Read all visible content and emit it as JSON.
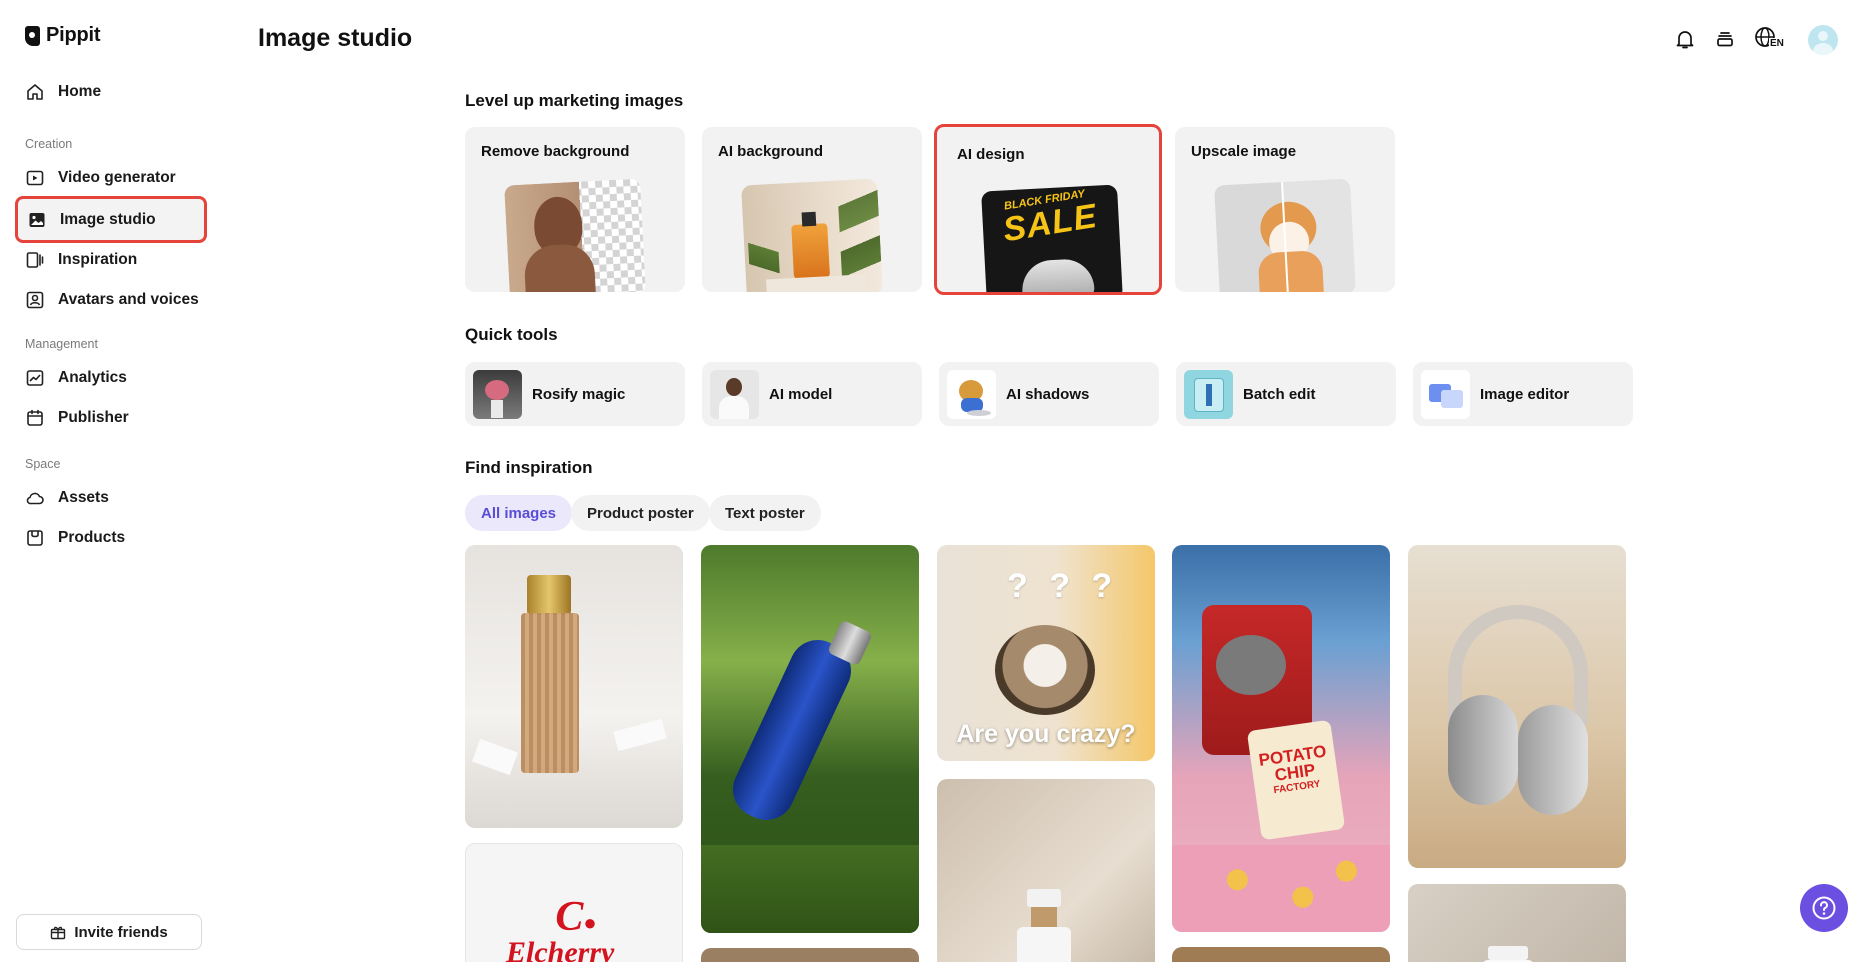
{
  "app": {
    "name": "Pippit"
  },
  "sidebar": {
    "home": "Home",
    "sections": {
      "creation": "Creation",
      "management": "Management",
      "space": "Space"
    },
    "items": {
      "video_generator": "Video generator",
      "image_studio": "Image studio",
      "inspiration": "Inspiration",
      "avatars_voices": "Avatars and voices",
      "analytics": "Analytics",
      "publisher": "Publisher",
      "assets": "Assets",
      "products": "Products"
    },
    "invite": "Invite friends"
  },
  "header": {
    "title": "Image studio",
    "language_badge": "EN"
  },
  "main": {
    "level_up": {
      "title": "Level up marketing images",
      "cards": [
        "Remove background",
        "AI background",
        "AI design",
        "Upscale image"
      ],
      "ai_design_thumb": {
        "line1": "BLACK FRIDAY",
        "line2": "SALE"
      }
    },
    "quick_tools": {
      "title": "Quick tools",
      "tools": [
        "Rosify magic",
        "AI model",
        "AI shadows",
        "Batch edit",
        "Image editor"
      ]
    },
    "inspiration": {
      "title": "Find inspiration",
      "filters": [
        "All images",
        "Product poster",
        "Text poster"
      ],
      "tile_texts": {
        "cat": "Are you crazy?",
        "cat_marks": "? ? ?",
        "chips_line1": "POTATO",
        "chips_line2": "CHIP",
        "chips_line3": "FACTORY",
        "brand": "Elcherry"
      }
    }
  },
  "colors": {
    "highlight": "#e5443b",
    "accent": "#6a4fe0",
    "filter_active_text": "#5b4ed6"
  }
}
